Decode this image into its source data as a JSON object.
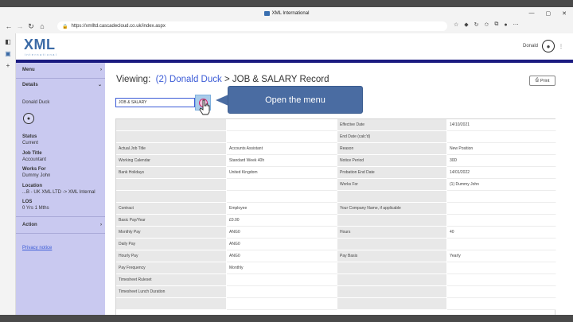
{
  "browser": {
    "window_title": "XML International",
    "url": "https://xmlltd.cascadecloud.co.uk/index.aspx"
  },
  "app": {
    "logo": "XML",
    "logo_tagline": "international",
    "user_name": "Donald"
  },
  "sidebar": {
    "menu": "Menu",
    "details": "Details",
    "person": "Donald Duck",
    "status_label": "Status",
    "status_value": "Current",
    "job_title_label": "Job Title",
    "job_title_value": "Accountant",
    "works_for_label": "Works For",
    "works_for_value": "Dummy John",
    "location_label": "Location",
    "location_value": "...B - UK XML LTD -> XML Internal",
    "los_label": "LOS",
    "los_value": "0 Yrs 1 Mths",
    "action": "Action",
    "privacy": "Privacy notice"
  },
  "main": {
    "viewing_label": "Viewing:",
    "person_link": "(2) Donald Duck",
    "separator": ">",
    "record_title": "JOB & SALARY Record",
    "print_label": "Print",
    "select_value": "JOB & SALARY",
    "callout": "Open the menu"
  },
  "grid_rows": [
    [
      "",
      "",
      "Effective Date",
      "14/10/2021"
    ],
    [
      "",
      "",
      "End Date (calc'd)",
      ""
    ],
    [
      "Actual Job Title",
      "Accounts Assistant",
      "Reason",
      "New Position"
    ],
    [
      "Working Calendar",
      "Standard Week 40h",
      "Notice Period",
      "30D"
    ],
    [
      "Bank Holidays",
      "United Kingdom",
      "Probation End Date",
      "14/01/2022"
    ],
    [
      "",
      "",
      "Works For",
      "(1) Dummy John"
    ],
    [
      "",
      "",
      "",
      ""
    ],
    [
      "Contract",
      "Employee",
      "Your Company Name, if applicable",
      ""
    ],
    [
      "Basic Pay/Year",
      "£0.00",
      "",
      ""
    ],
    [
      "Monthly Pay",
      "ANG0",
      "Hours",
      "40"
    ],
    [
      "Daily Pay",
      "ANG0",
      "",
      ""
    ],
    [
      "Hourly Pay",
      "ANG0",
      "Pay Basis",
      "Yearly"
    ],
    [
      "Pay Frequency",
      "Monthly",
      "",
      ""
    ],
    [
      "Timesheet Ruleset",
      "",
      "",
      ""
    ],
    [
      "Timesheet Lunch Duration",
      "",
      "",
      ""
    ],
    [
      "",
      "",
      "",
      ""
    ]
  ]
}
